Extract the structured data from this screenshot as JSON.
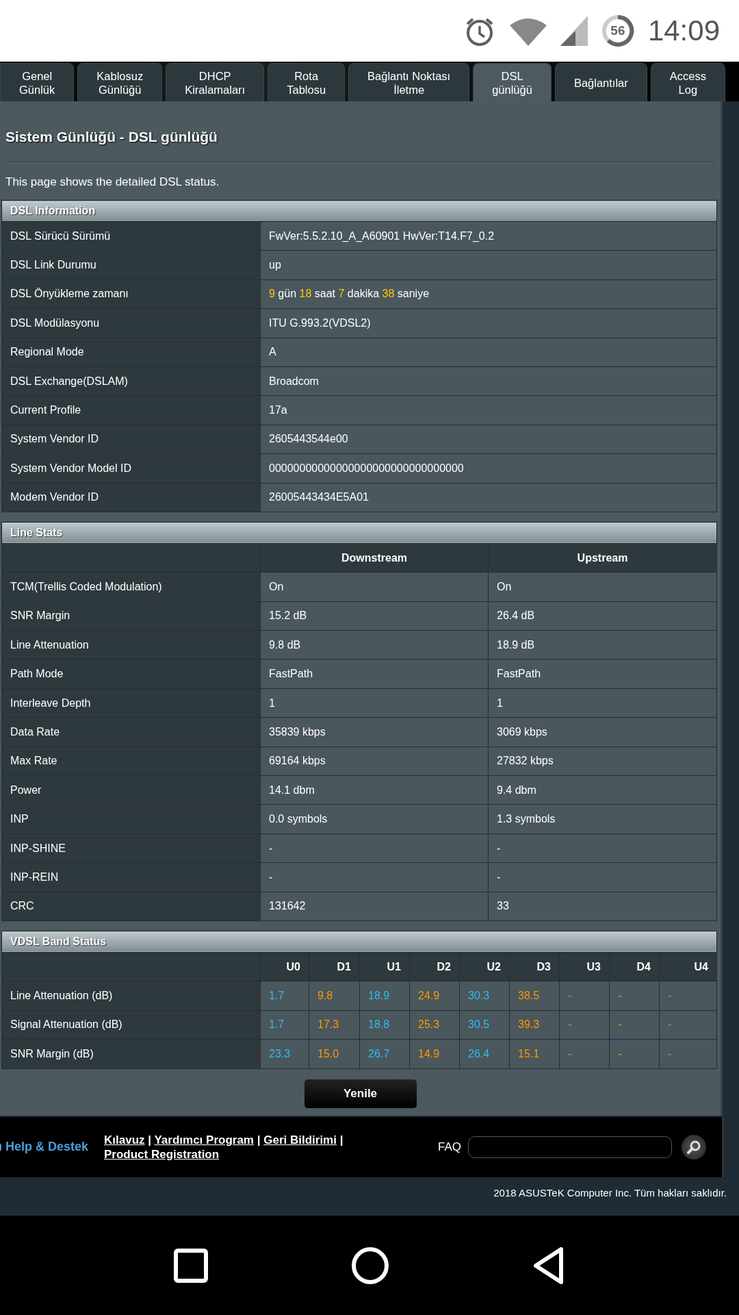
{
  "status_bar": {
    "battery": "56",
    "time": "14:09"
  },
  "tabs": [
    {
      "label": "Genel\nGünlük",
      "selected": false
    },
    {
      "label": "Kablosuz\nGünlüğü",
      "selected": false
    },
    {
      "label": "DHCP\nKiralamaları",
      "selected": false
    },
    {
      "label": "Rota\nTablosu",
      "selected": false
    },
    {
      "label": "Bağlantı Noktası\nİletme",
      "selected": false
    },
    {
      "label": "DSL\ngünlüğü",
      "selected": true
    },
    {
      "label": "Bağlantılar",
      "selected": false
    },
    {
      "label": "Access\nLog",
      "selected": false
    }
  ],
  "page_title": "Sistem Günlüğü - DSL günlüğü",
  "description": "This page shows the detailed DSL status.",
  "dsl_information": {
    "title": "DSL Information",
    "rows": [
      {
        "label": "DSL Sürücü Sürümü",
        "value": "FwVer:5.5.2.10_A_A60901 HwVer:T14.F7_0.2"
      },
      {
        "label": "DSL Link Durumu",
        "value": "up"
      },
      {
        "label": "DSL Önyükleme zamanı",
        "segments": [
          {
            "text": "9",
            "kind": "number"
          },
          {
            "text": "gün",
            "kind": "unit"
          },
          {
            "text": "18",
            "kind": "number"
          },
          {
            "text": "saat",
            "kind": "unit"
          },
          {
            "text": "7",
            "kind": "number"
          },
          {
            "text": "dakika",
            "kind": "unit"
          },
          {
            "text": "38",
            "kind": "number"
          },
          {
            "text": "saniye",
            "kind": "unit"
          }
        ]
      },
      {
        "label": "DSL Modülasyonu",
        "value": "ITU G.993.2(VDSL2)"
      },
      {
        "label": "Regional Mode",
        "value": "A"
      },
      {
        "label": "DSL Exchange(DSLAM)",
        "value": "Broadcom"
      },
      {
        "label": "Current Profile",
        "value": "17a"
      },
      {
        "label": "System Vendor ID",
        "value": "2605443544e00"
      },
      {
        "label": "System Vendor Model ID",
        "value": "00000000000000000000000000000000"
      },
      {
        "label": "Modem Vendor ID",
        "value": "26005443434E5A01"
      }
    ]
  },
  "line_stats": {
    "title": "Line Stats",
    "columns": [
      "Downstream",
      "Upstream"
    ],
    "rows": [
      {
        "label": "TCM(Trellis Coded Modulation)",
        "values": [
          "On",
          "On"
        ]
      },
      {
        "label": "SNR Margin",
        "values": [
          "15.2 dB",
          "26.4 dB"
        ]
      },
      {
        "label": "Line Attenuation",
        "values": [
          "9.8 dB",
          "18.9 dB"
        ]
      },
      {
        "label": "Path Mode",
        "values": [
          "FastPath",
          "FastPath"
        ]
      },
      {
        "label": "Interleave Depth",
        "values": [
          "1",
          "1"
        ]
      },
      {
        "label": "Data Rate",
        "values": [
          "35839 kbps",
          "3069 kbps"
        ]
      },
      {
        "label": "Max Rate",
        "values": [
          "69164 kbps",
          "27832 kbps"
        ]
      },
      {
        "label": "Power",
        "values": [
          "14.1 dbm",
          "9.4 dbm"
        ]
      },
      {
        "label": "INP",
        "values": [
          "0.0 symbols",
          "1.3 symbols"
        ]
      },
      {
        "label": "INP-SHINE",
        "values": [
          "-",
          "-"
        ]
      },
      {
        "label": "INP-REIN",
        "values": [
          "-",
          "-"
        ]
      },
      {
        "label": "CRC",
        "values": [
          "131642",
          "33"
        ]
      }
    ]
  },
  "vdsl_band_status": {
    "title": "VDSL Band Status",
    "columns": [
      {
        "label": "U0",
        "kind": "up"
      },
      {
        "label": "D1",
        "kind": "down"
      },
      {
        "label": "U1",
        "kind": "up"
      },
      {
        "label": "D2",
        "kind": "down"
      },
      {
        "label": "U2",
        "kind": "up"
      },
      {
        "label": "D3",
        "kind": "down"
      },
      {
        "label": "U3",
        "kind": "up"
      },
      {
        "label": "D4",
        "kind": "down"
      },
      {
        "label": "U4",
        "kind": "up"
      }
    ],
    "rows": [
      {
        "label": "Line Attenuation (dB)",
        "values": [
          "1.7",
          "9.8",
          "18.9",
          "24.9",
          "30.3",
          "38.5",
          "-",
          "-",
          "-"
        ]
      },
      {
        "label": "Signal Attenuation (dB)",
        "values": [
          "1.7",
          "17.3",
          "18.8",
          "25.3",
          "30.5",
          "39.3",
          "-",
          "-",
          "-"
        ]
      },
      {
        "label": "SNR Margin (dB)",
        "values": [
          "23.3",
          "15.0",
          "26.7",
          "14.9",
          "26.4",
          "15.1",
          "-",
          "-",
          "-"
        ]
      }
    ]
  },
  "refresh_button": "Yenile",
  "footer": {
    "help": "Help & Destek",
    "links": [
      "Kılavuz",
      "Yardımcı Program",
      "Geri Bildirimi",
      "Product Registration"
    ],
    "separator": "|",
    "faq_label": "FAQ",
    "copyright": "2018 ASUSTeK Computer Inc. Tüm hakları saklıdır."
  }
}
